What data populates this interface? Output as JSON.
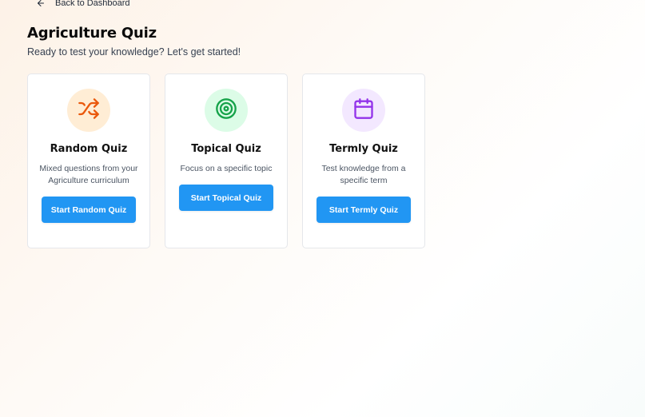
{
  "nav": {
    "back_label": "Back to Dashboard",
    "back_icon": "arrow-left-icon"
  },
  "header": {
    "title": "Agriculture Quiz",
    "subtitle": "Ready to test your knowledge? Let's get started!"
  },
  "cards": [
    {
      "title": "Random Quiz",
      "description": "Mixed questions from your Agriculture curriculum",
      "button_label": "Start Random Quiz",
      "icon": "shuffle-icon",
      "icon_color": "#ea580c",
      "icon_bg": "#ffedd5"
    },
    {
      "title": "Topical Quiz",
      "description": "Focus on a specific topic",
      "button_label": "Start Topical Quiz",
      "icon": "target-icon",
      "icon_color": "#16a34a",
      "icon_bg": "#dcfce7"
    },
    {
      "title": "Termly Quiz",
      "description": "Test knowledge from a specific term",
      "button_label": "Start Termly Quiz",
      "icon": "calendar-icon",
      "icon_color": "#9333ea",
      "icon_bg": "#f3e8ff"
    }
  ],
  "colors": {
    "button_bg": "#2196f3",
    "button_text": "#ffffff"
  }
}
